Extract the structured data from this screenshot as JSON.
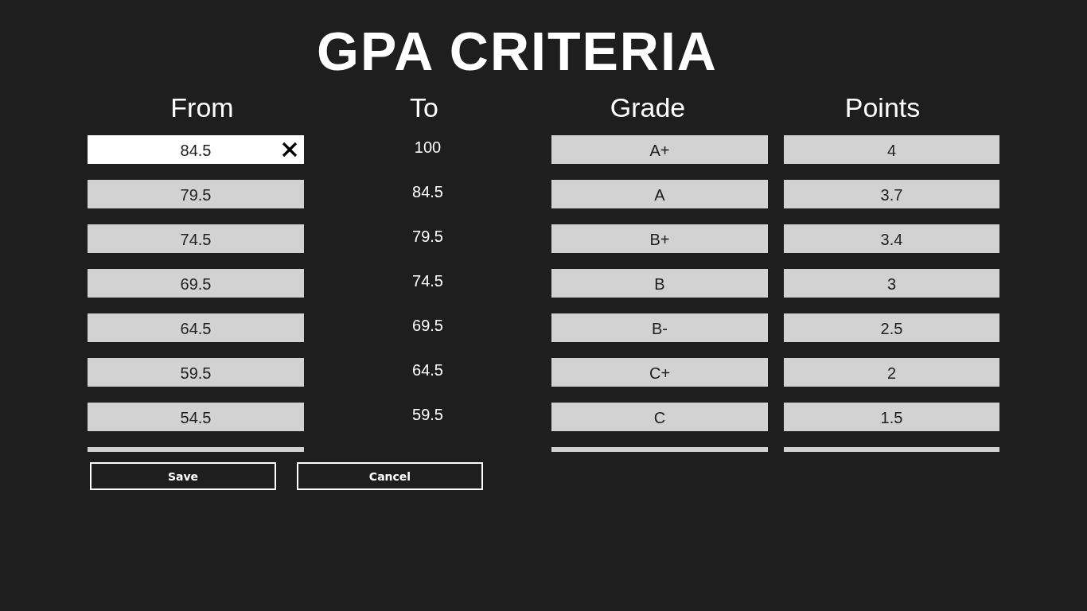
{
  "title": "GPA CRITERIA",
  "columns": [
    "From",
    "To",
    "Grade",
    "Points"
  ],
  "rows": [
    {
      "from": "84.5",
      "from_focused": true,
      "to": "100",
      "grade": "A+",
      "points": "4"
    },
    {
      "from": "79.5",
      "from_focused": false,
      "to": "84.5",
      "grade": "A",
      "points": "3.7"
    },
    {
      "from": "74.5",
      "from_focused": false,
      "to": "79.5",
      "grade": "B+",
      "points": "3.4"
    },
    {
      "from": "69.5",
      "from_focused": false,
      "to": "74.5",
      "grade": "B",
      "points": "3"
    },
    {
      "from": "64.5",
      "from_focused": false,
      "to": "69.5",
      "grade": "B-",
      "points": "2.5"
    },
    {
      "from": "59.5",
      "from_focused": false,
      "to": "64.5",
      "grade": "C+",
      "points": "2"
    },
    {
      "from": "54.5",
      "from_focused": false,
      "to": "59.5",
      "grade": "C",
      "points": "1.5"
    }
  ],
  "more_rows_below": true,
  "buttons": [
    "Save",
    "Cancel"
  ]
}
